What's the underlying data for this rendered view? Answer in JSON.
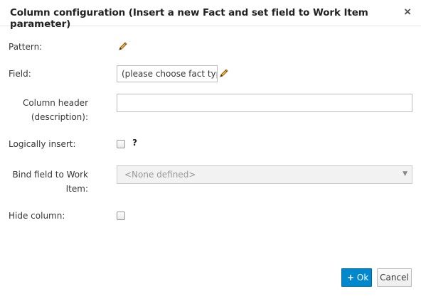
{
  "dialog": {
    "title": "Column configuration (Insert a new Fact and set field to Work Item parameter)",
    "close_glyph": "×"
  },
  "form": {
    "pattern_label": "Pattern:",
    "field_label": "Field:",
    "field_value": "(please choose fact typ",
    "column_header_label_line1": "Column header",
    "column_header_label_line2": "(description):",
    "column_header_value": "",
    "logically_insert_label": "Logically insert:",
    "logically_insert_checked": false,
    "help_glyph": "?",
    "bind_field_label_line1": "Bind field to Work",
    "bind_field_label_line2": "Item:",
    "bind_field_selected": "<None defined>",
    "hide_column_label": "Hide column:",
    "hide_column_checked": false
  },
  "buttons": {
    "ok_icon": "+",
    "ok_label": "Ok",
    "cancel_label": "Cancel"
  },
  "icons": {
    "pattern_edit": "pencil-icon",
    "field_edit": "pencil-icon",
    "close": "close-icon",
    "dropdown": "chevron-down-icon",
    "ok": "plus-icon"
  },
  "colors": {
    "primary": "#0088ce",
    "pencil": "#e5a32a"
  }
}
